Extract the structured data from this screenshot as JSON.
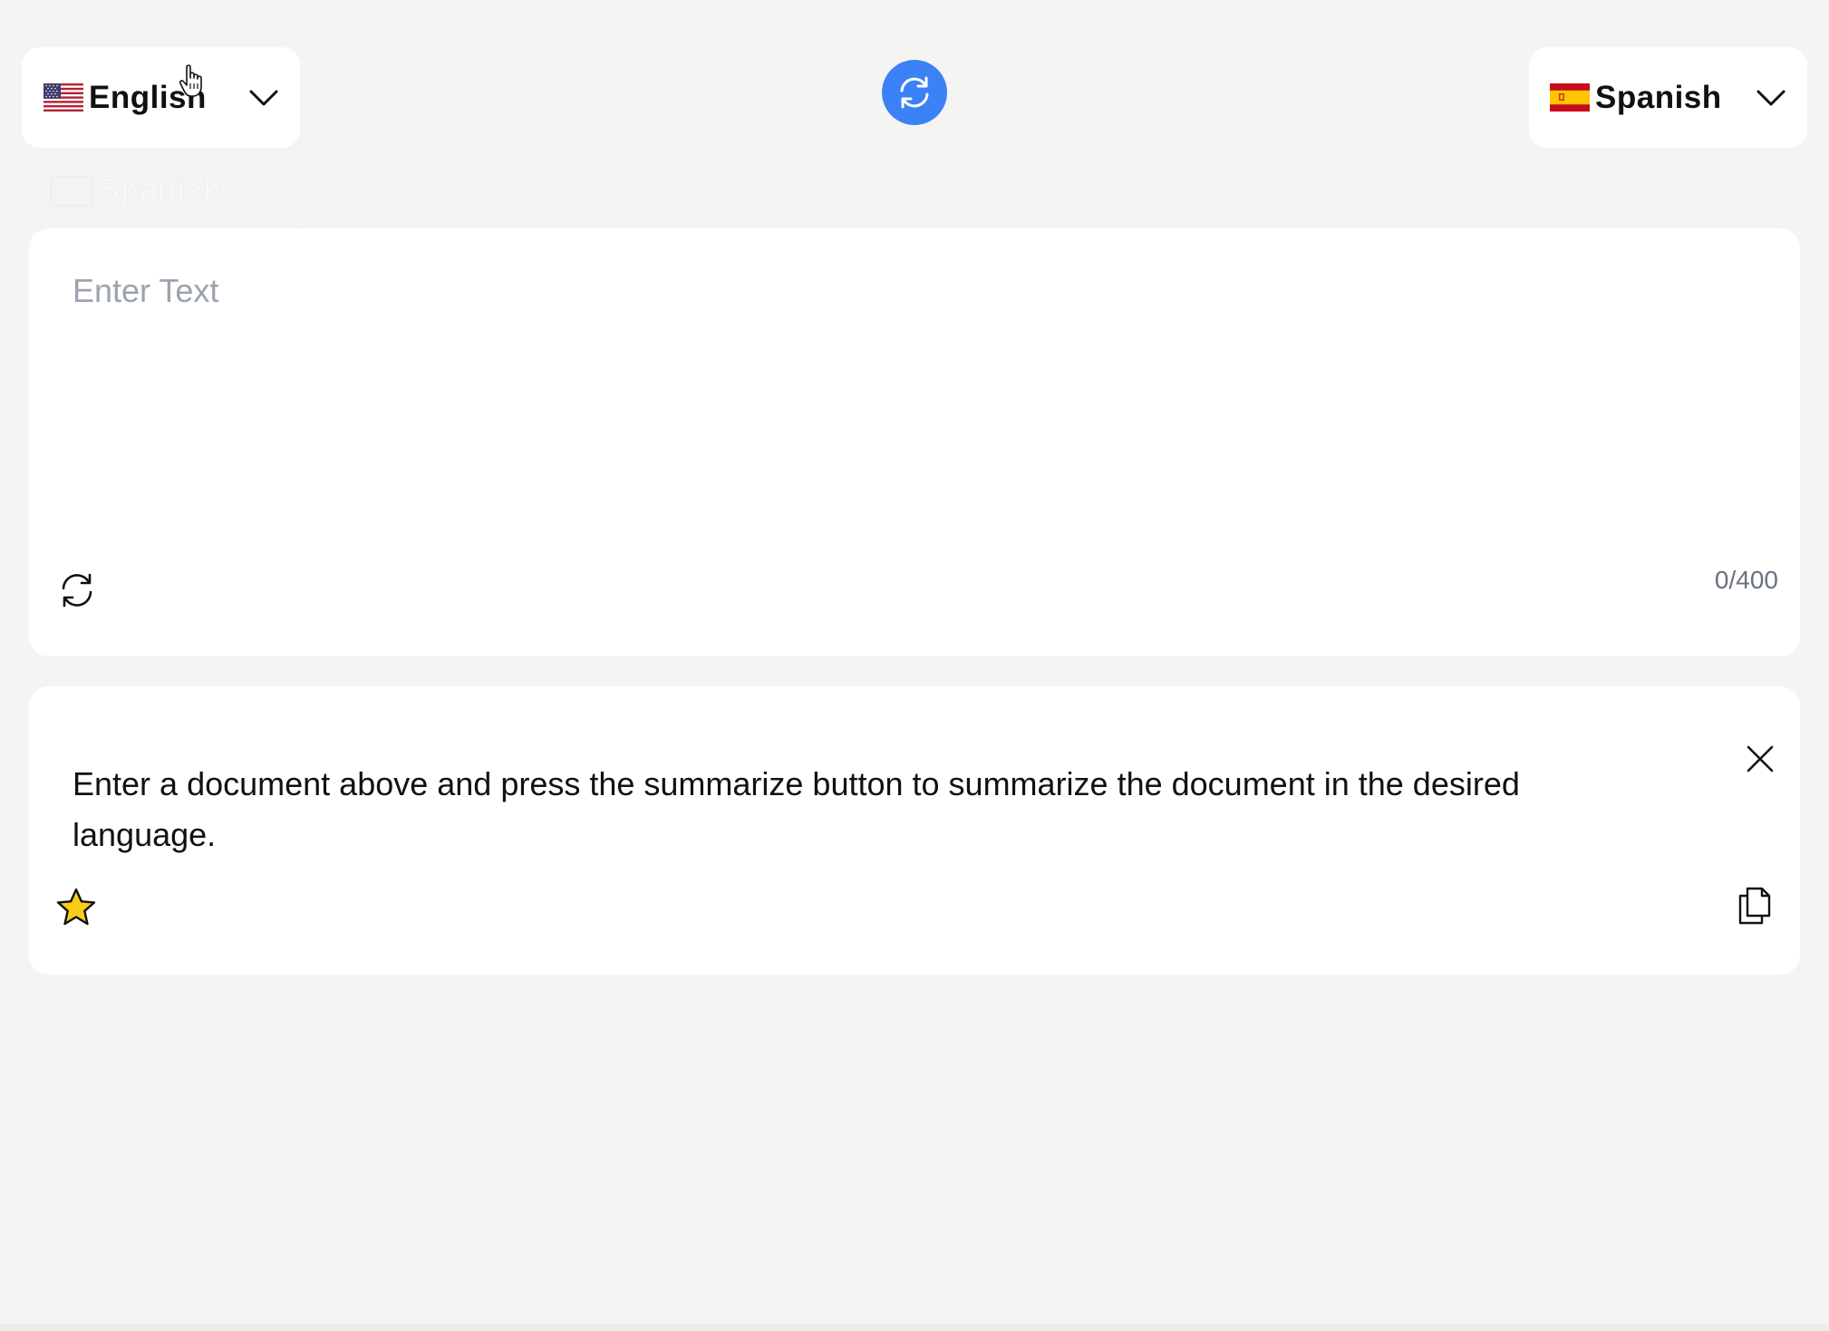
{
  "source_language": {
    "label": "English",
    "flag": "us-flag-icon"
  },
  "target_language": {
    "label": "Spanish",
    "flag": "spain-flag-icon"
  },
  "ghost_option": {
    "label": "Spanish"
  },
  "swap": {
    "icon": "swap-icon"
  },
  "input": {
    "placeholder": "Enter Text",
    "value": "",
    "char_count": "0/400"
  },
  "output": {
    "text": "Enter a document above and press the summarize button to summarize the document in the desired language."
  },
  "colors": {
    "accent": "#3b82f6",
    "background": "#f4f4f3",
    "card": "#ffffff",
    "placeholder": "#9ca3af",
    "counter": "#6b7280",
    "star_fill": "#facc15"
  }
}
